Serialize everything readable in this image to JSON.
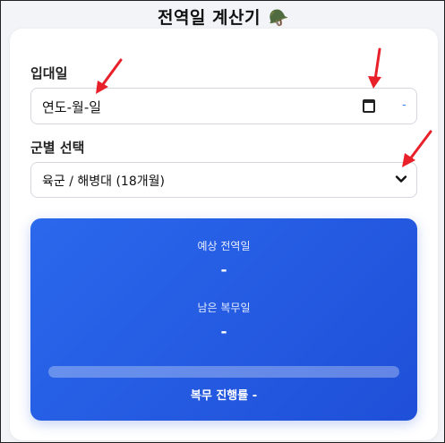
{
  "app": {
    "title": "전역일 계산기",
    "title_emoji": "🪖"
  },
  "enlistment": {
    "label": "입대일",
    "value": "연도-월-일",
    "suffix": "-"
  },
  "branch": {
    "label": "군별 선택",
    "selected": "육군 / 해병대 (18개월)"
  },
  "result": {
    "discharge_label": "예상 전역일",
    "discharge_value": "-",
    "remaining_label": "남은 복무일",
    "remaining_value": "-",
    "progress_text": "복무 진행률 -",
    "progress_fraction": 0
  },
  "colors": {
    "accent": "#2a68ec",
    "annotation_arrow": "#e8202a"
  }
}
